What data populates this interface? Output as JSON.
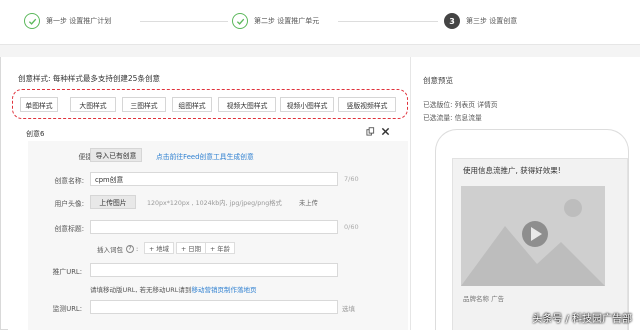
{
  "steps": [
    {
      "label": "第一步 设置推广计划",
      "state": "done"
    },
    {
      "label": "第二步 设置推广单元",
      "state": "done"
    },
    {
      "label": "第三步 设置创意",
      "state": "active",
      "number": "3"
    }
  ],
  "creative_styles": {
    "title": "创意样式: 每种样式最多支持创建25条创意",
    "options": [
      "单图样式",
      "大图样式",
      "三图样式",
      "组图样式",
      "视频大图样式",
      "视频小图样式",
      "竖版视频样式"
    ]
  },
  "creative": {
    "header": "创意6",
    "quick_action": {
      "label": "便捷操作:",
      "button": "导入已有创意",
      "link": "点击前往Feed创意工具生成创意"
    },
    "name": {
      "label": "创意名称:",
      "value": "cpm创意",
      "counter": "7/60"
    },
    "avatar": {
      "label": "用户头像:",
      "button": "上传图片",
      "hint": "120px*120px , 1024kb内, jpg/jpeg/png格式",
      "status": "未上传"
    },
    "title": {
      "label": "创意标题:",
      "value": "",
      "counter": "0/60"
    },
    "insert_word": {
      "label": "插入词包",
      "tags": [
        "+ 地域",
        "+ 日期",
        "+ 年龄"
      ]
    },
    "url": {
      "label": "推广URL:",
      "value": "",
      "hint_prefix": "请填移动版URL, 若无移动URL请到",
      "hint_link": "移动营销页制作落地页"
    },
    "monitor_url": {
      "label": "监测URL:",
      "value": "",
      "note": "选填"
    }
  },
  "preview": {
    "title": "创意预览",
    "placement": "已选版位: 列表页 详情页",
    "traffic": "已选流量: 信息流量",
    "ad_text": "使用信息流推广, 获得好效果!",
    "brand": "品牌名称 广告"
  },
  "watermark": "头条号 / 科技园广告部",
  "colors": {
    "accent": "#2f80d1",
    "done": "#5cb85c",
    "highlight": "#e0323c"
  }
}
